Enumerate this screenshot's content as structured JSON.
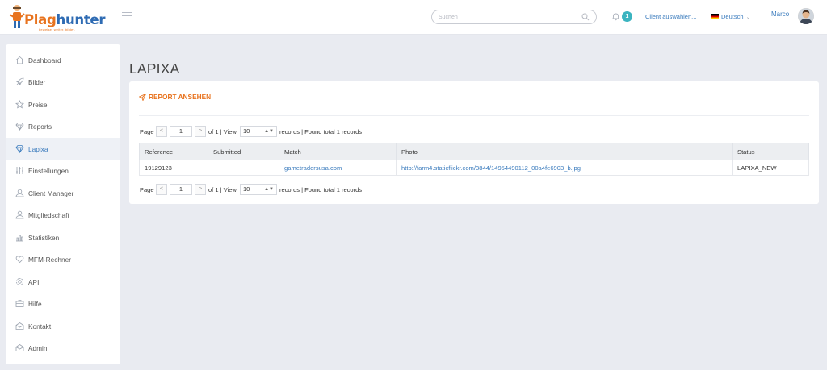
{
  "header": {
    "logo_text_1": "Plag",
    "logo_text_2": "hunter",
    "logo_tagline": "beweise. weiter. bilder.",
    "search_placeholder": "Suchen",
    "notification_count": "1",
    "client_select": "Client auswählen...",
    "language": "Deutsch",
    "user_name": "Marco"
  },
  "sidebar": {
    "items": [
      {
        "label": "Dashboard",
        "icon": "home-icon"
      },
      {
        "label": "Bilder",
        "icon": "rocket-icon"
      },
      {
        "label": "Preise",
        "icon": "star-icon"
      },
      {
        "label": "Reports",
        "icon": "diamond-icon"
      },
      {
        "label": "Lapixa",
        "icon": "diamond-icon"
      },
      {
        "label": "Einstellungen",
        "icon": "sliders-icon"
      },
      {
        "label": "Client Manager",
        "icon": "user-icon"
      },
      {
        "label": "Mitgliedschaft",
        "icon": "user-icon"
      },
      {
        "label": "Statistiken",
        "icon": "bar-chart-icon"
      },
      {
        "label": "MFM-Rechner",
        "icon": "heart-icon"
      },
      {
        "label": "API",
        "icon": "gear-icon"
      },
      {
        "label": "Hilfe",
        "icon": "briefcase-icon"
      },
      {
        "label": "Kontakt",
        "icon": "envelope-icon"
      },
      {
        "label": "Admin",
        "icon": "envelope-icon"
      }
    ],
    "active_label": "Lapixa"
  },
  "main": {
    "title": "LAPIXA",
    "report_link": "REPORT ANSEHEN",
    "pager": {
      "page_label": "Page",
      "prev": "<",
      "next": ">",
      "page_value": "1",
      "of_text": "of 1 | View",
      "view_value": "10",
      "records_text": "records | Found total 1 records"
    },
    "table": {
      "headers": [
        "Reference",
        "Submitted",
        "Match",
        "Photo",
        "Status"
      ],
      "rows": [
        [
          "19129123",
          "",
          "gametradersusa.com",
          "http://farm4.staticflickr.com/3844/14954490112_00a4fe6903_b.jpg",
          "LAPIXA_NEW"
        ]
      ]
    }
  },
  "colors": {
    "accent_orange": "#e8731e",
    "link_blue": "#3a7bbd",
    "badge_teal": "#3bb4c0",
    "page_bg": "#e9ebf1"
  }
}
